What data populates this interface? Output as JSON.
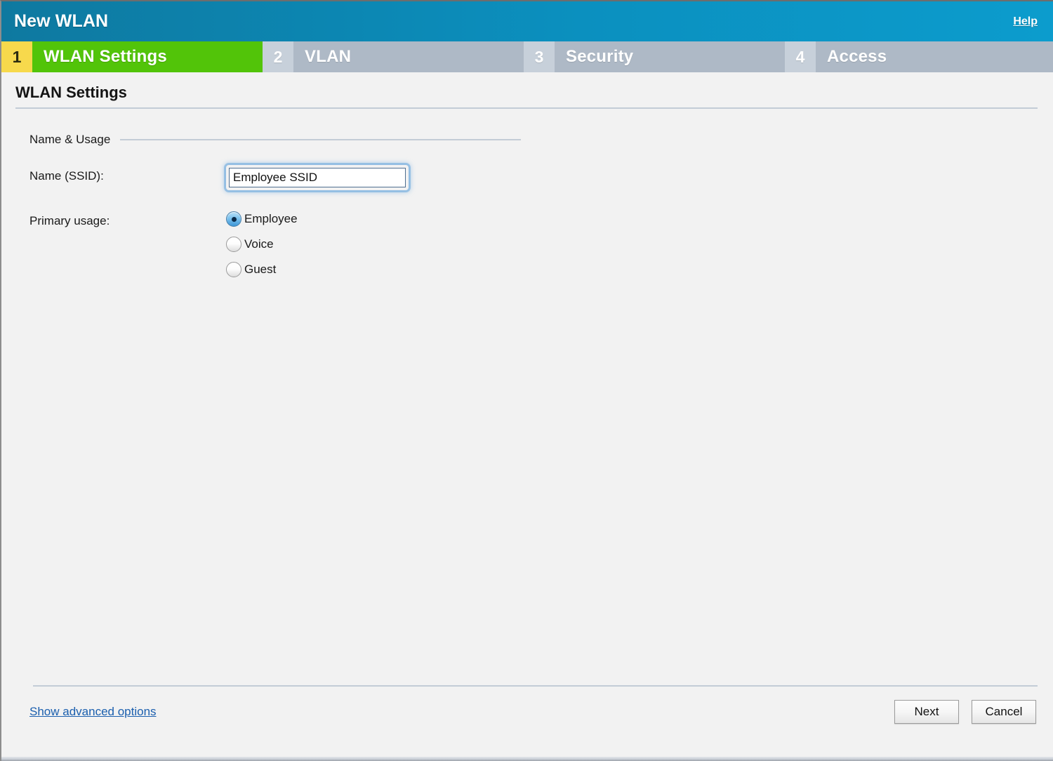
{
  "window": {
    "title": "New WLAN",
    "help_label": "Help"
  },
  "steps": [
    {
      "number": "1",
      "label": "WLAN Settings",
      "state": "active"
    },
    {
      "number": "2",
      "label": "VLAN",
      "state": "inactive"
    },
    {
      "number": "3",
      "label": "Security",
      "state": "inactive"
    },
    {
      "number": "4",
      "label": "Access",
      "state": "inactive"
    }
  ],
  "page": {
    "heading": "WLAN Settings",
    "group_header": "Name & Usage",
    "ssid": {
      "label": "Name (SSID):",
      "value": "Employee SSID",
      "placeholder": ""
    },
    "primary_usage": {
      "label": "Primary usage:",
      "options": [
        {
          "label": "Employee",
          "selected": true
        },
        {
          "label": "Voice",
          "selected": false
        },
        {
          "label": "Guest",
          "selected": false
        }
      ]
    }
  },
  "footer": {
    "advanced_link": "Show advanced options",
    "next_label": "Next",
    "cancel_label": "Cancel"
  },
  "colors": {
    "titlebar_left": "#0e79a0",
    "titlebar_right": "#0c9ccd",
    "step_active_number_bg": "#f7d94c",
    "step_active_label_bg": "#52c409",
    "step_inactive_number_bg": "#c7d0da",
    "step_inactive_label_bg": "#aeb9c6",
    "link_blue": "#1b5fae",
    "body_bg": "#f2f2f2",
    "rule": "#c3ccd6"
  }
}
